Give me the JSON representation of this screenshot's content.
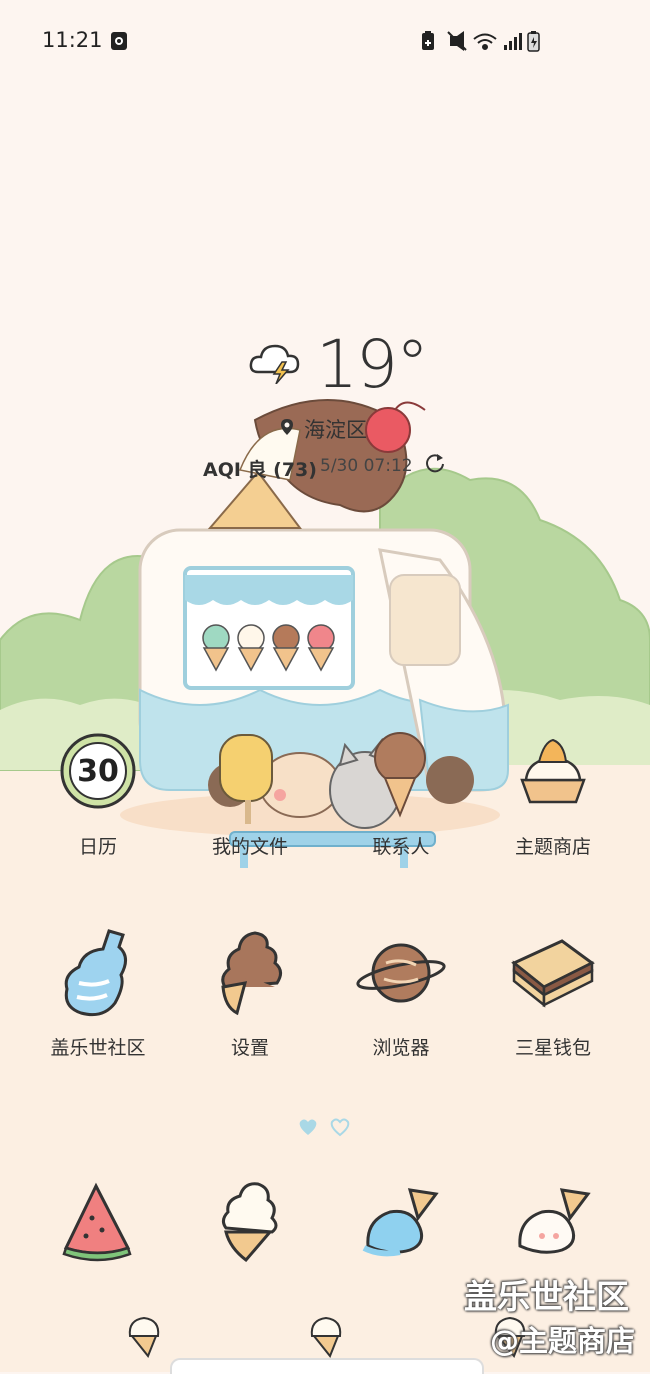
{
  "status_bar": {
    "time": "11:21",
    "left_icons": [
      "screen-record-icon"
    ],
    "right_icons": [
      "battery-saver-icon",
      "mute-vibrate-icon",
      "wifi-icon",
      "signal-icon",
      "battery-charging-icon"
    ]
  },
  "weather": {
    "icon": "thunderstorm-cloud-icon",
    "temperature": "19°",
    "location": "海淀区",
    "aqi": "AQI 良 (73)",
    "updated": "5/30 07:12",
    "refresh_icon": "refresh-icon"
  },
  "apps_row1": [
    {
      "label": "日历",
      "icon": "calendar-icon",
      "badge": "30"
    },
    {
      "label": "我的文件",
      "icon": "my-files-icon"
    },
    {
      "label": "联系人",
      "icon": "contacts-icon"
    },
    {
      "label": "主题商店",
      "icon": "theme-store-icon"
    }
  ],
  "apps_row2": [
    {
      "label": "盖乐世社区",
      "icon": "bottle-icon"
    },
    {
      "label": "设置",
      "icon": "chocolate-cone-icon"
    },
    {
      "label": "浏览器",
      "icon": "planet-icon"
    },
    {
      "label": "三星钱包",
      "icon": "wafer-icon"
    }
  ],
  "page_indicator": {
    "pages": 2,
    "current": 1
  },
  "dock": [
    {
      "icon": "watermelon-icon"
    },
    {
      "icon": "vanilla-cone-icon"
    },
    {
      "icon": "blue-scoop-icon"
    },
    {
      "icon": "white-scoop-icon"
    }
  ],
  "watermark": {
    "line1": "盖乐世社区",
    "line2": "@主题商店"
  },
  "colors": {
    "background": "#fdf5f0",
    "bush": "#b9d7a0",
    "truck_blue": "#bfe3ec"
  }
}
